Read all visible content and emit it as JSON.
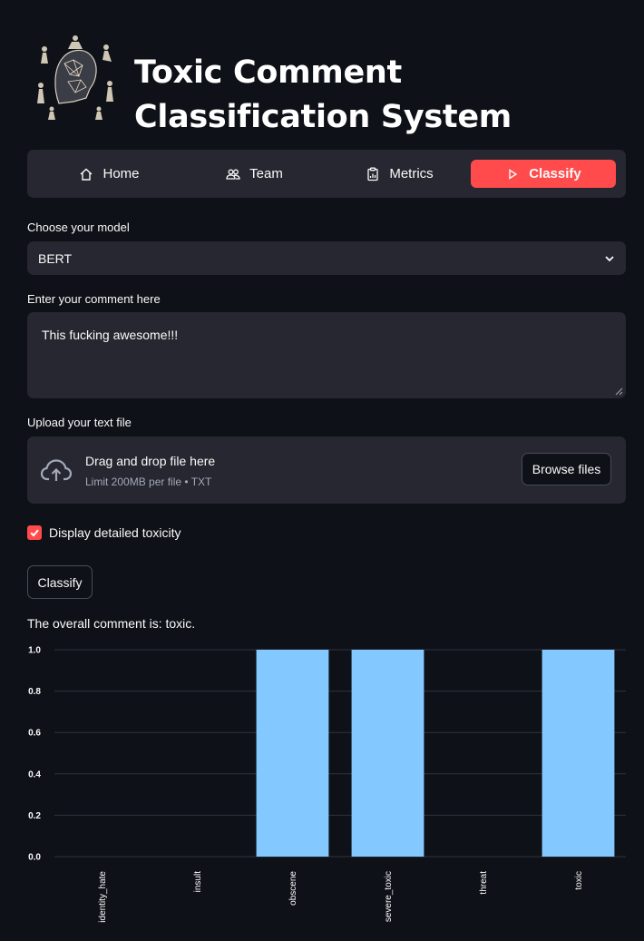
{
  "app": {
    "title": "Toxic Comment Classification System"
  },
  "nav": {
    "items": [
      {
        "label": "Home",
        "icon": "home-icon",
        "active": false
      },
      {
        "label": "Team",
        "icon": "team-icon",
        "active": false
      },
      {
        "label": "Metrics",
        "icon": "clipboard-icon",
        "active": false
      },
      {
        "label": "Classify",
        "icon": "play-icon",
        "active": true
      }
    ]
  },
  "model": {
    "label": "Choose your model",
    "selected": "BERT"
  },
  "comment": {
    "label": "Enter your comment here",
    "value": "This fucking awesome!!!"
  },
  "upload": {
    "label": "Upload your text file",
    "drop_text": "Drag and drop file here",
    "limit_text": "Limit 200MB per file • TXT",
    "browse_label": "Browse files"
  },
  "options": {
    "detailed_label": "Display detailed toxicity",
    "detailed_checked": true
  },
  "actions": {
    "classify_label": "Classify"
  },
  "result": {
    "text": "The overall comment is: toxic."
  },
  "colors": {
    "accent": "#ff4b4b",
    "bar": "#83c9ff",
    "background": "#0e1117",
    "widget": "#262730"
  },
  "chart_data": {
    "type": "bar",
    "categories": [
      "identity_hate",
      "insult",
      "obscene",
      "severe_toxic",
      "threat",
      "toxic"
    ],
    "values": [
      0,
      0,
      1,
      1,
      0,
      1
    ],
    "yticks": [
      "0.0",
      "0.2",
      "0.4",
      "0.6",
      "0.8",
      "1.0"
    ],
    "ylim": [
      0,
      1
    ],
    "grid": true,
    "xlabel": "",
    "ylabel": ""
  }
}
